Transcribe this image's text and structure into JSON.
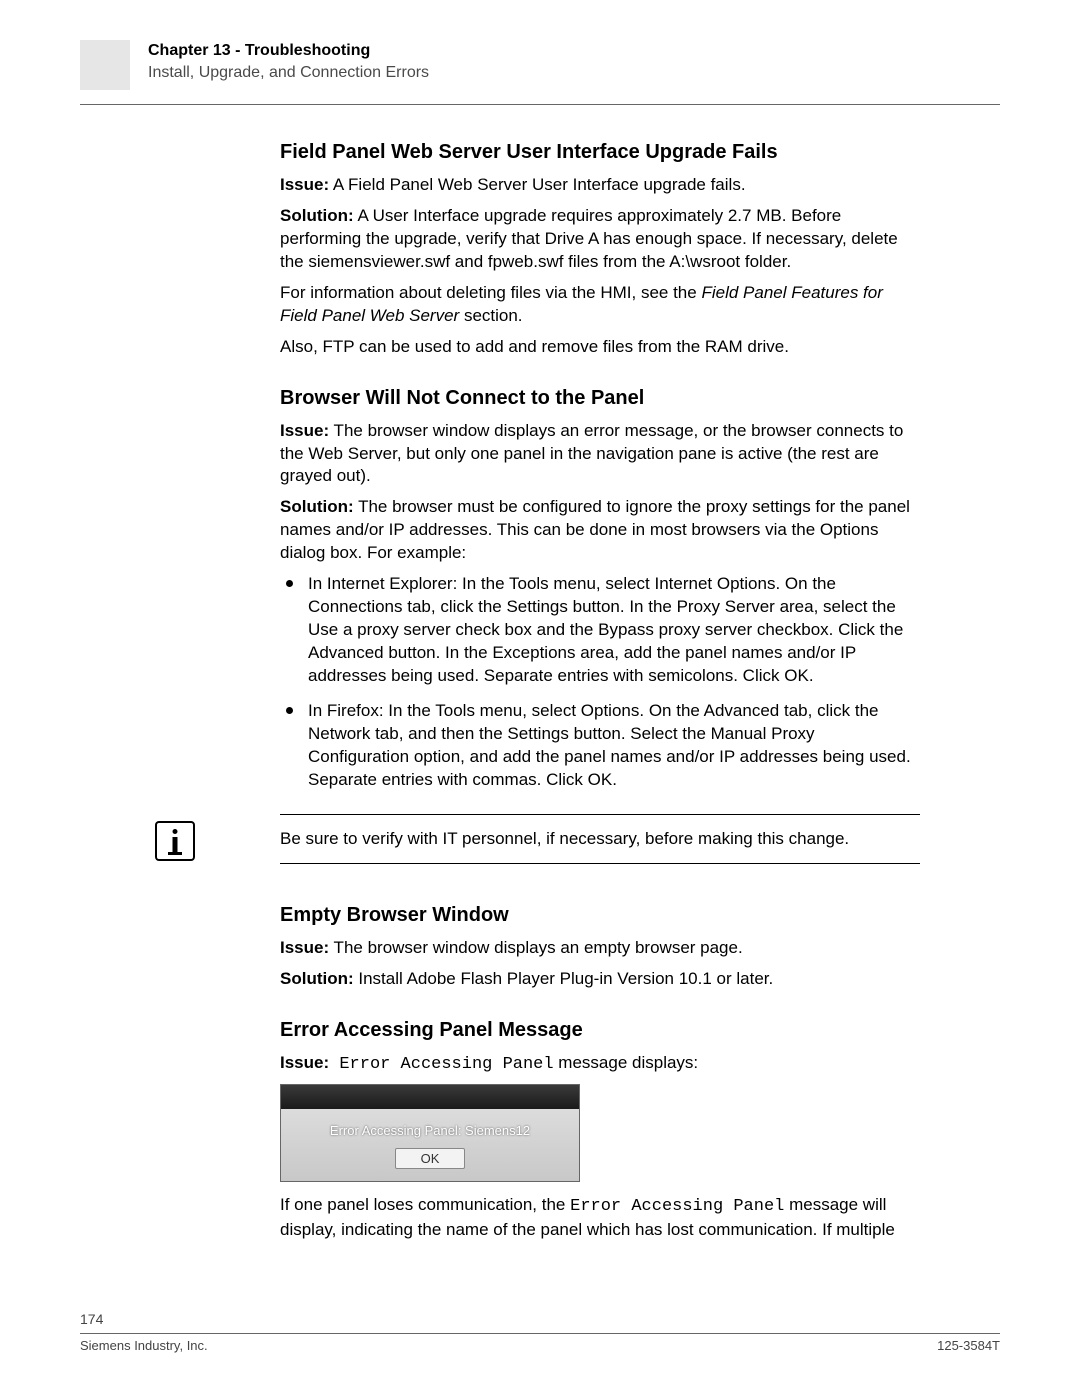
{
  "header": {
    "chapter_prefix": "Chapter 13 - ",
    "chapter_name": "Troubleshooting",
    "section": "Install, Upgrade, and Connection Errors"
  },
  "s1": {
    "heading": "Field Panel Web Server User Interface Upgrade Fails",
    "issue_label": "Issue:",
    "issue_text": " A Field Panel Web Server User Interface upgrade fails.",
    "sol_label": "Solution:",
    "sol_text": " A User Interface upgrade requires approximately 2.7 MB. Before performing the upgrade, verify that Drive A has enough space. If necessary, delete the siemensviewer.swf and fpweb.swf files from the A:\\wsroot folder.",
    "p3a": "For information about deleting files via the HMI, see the ",
    "p3i": "Field Panel Features for Field Panel Web Server",
    "p3b": " section.",
    "p4": "Also, FTP can be used to add and remove files from the RAM drive."
  },
  "s2": {
    "heading": "Browser Will Not Connect to the Panel",
    "issue_label": "Issue:",
    "issue_text": " The browser window displays an error message, or the browser connects to the Web Server, but only one panel in the navigation pane is active (the rest are grayed out).",
    "sol_label": "Solution:",
    "sol_text": " The browser must be configured to ignore the proxy settings for the panel names and/or IP addresses. This can be done in most browsers via the Options dialog box. For example:",
    "b1": {
      "t1": "In Internet Explorer: In the ",
      "b1b": "Tools",
      "t2": " menu, select ",
      "b2b": "Internet Options",
      "t3": ". On the ",
      "b3b": "Connections",
      "t4": " tab, click the ",
      "b4b": "Settings",
      "t5": " button. In the ",
      "b5b": "Proxy Server",
      "t6": " area, select the ",
      "b6b": "Use a proxy server",
      "t7": " check box and the ",
      "b7b": "Bypass proxy server",
      "t8": " checkbox. Click the ",
      "b8b": "Advanced",
      "t9": " button. In the ",
      "b9b": "Exceptions",
      "t10": " area, add the panel names and/or IP addresses being used. Separate entries with semicolons. Click ",
      "b10b": "OK",
      "t11": "."
    },
    "b2": {
      "t1": "In Firefox: In the ",
      "b1b": "Tools",
      "t2": " menu, select ",
      "b2b": "Options",
      "t3": ". On the ",
      "b3b": "Advanced",
      "t4": " tab, click the ",
      "b4b": "Network",
      "t5": " tab, and then the ",
      "b5b": "Settings",
      "t6": " button. Select the ",
      "b6b": "Manual Proxy Configuration",
      "t7": " option, and add the panel names and/or IP addresses being used. Separate entries with commas. Click ",
      "b7b": "OK",
      "t8": "."
    }
  },
  "note": {
    "text": "Be sure to verify with IT personnel, if necessary, before making this change."
  },
  "s3": {
    "heading": "Empty Browser Window",
    "issue_label": "Issue:",
    "issue_text": " The browser window displays an empty browser page.",
    "sol_label": "Solution:",
    "sol_text": " Install Adobe Flash Player Plug-in Version 10.1 or later."
  },
  "s4": {
    "heading": "Error Accessing Panel Message",
    "issue_label": "Issue:",
    "issue_code": " Error Accessing Panel",
    "issue_tail": " message displays:",
    "dialog_msg": "Error Accessing Panel: Siemens12",
    "dialog_btn": "OK",
    "after1a": "If one panel loses communication, the ",
    "after1code": "Error Accessing Panel",
    "after1b": " message will display, indicating the name of the panel which has lost communication. If multiple"
  },
  "footer": {
    "page": "174",
    "company": "Siemens Industry, Inc.",
    "docnum": "125-3584T"
  }
}
